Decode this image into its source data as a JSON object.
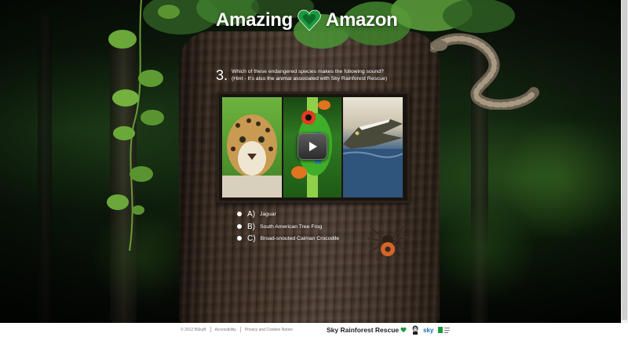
{
  "header": {
    "title_left": "Amazing",
    "title_right": "Amazon",
    "heart_color": "#1a9a3c"
  },
  "question": {
    "number": "3.",
    "text": "Which of these endangered species makes the following sound?",
    "hint": "(Hint - It's also the animal associated with Sky Rainforest Rescue)"
  },
  "media": {
    "images": [
      "jaguar-photo",
      "tree-frog-photo",
      "caiman-photo"
    ],
    "play_icon": "play-icon"
  },
  "options": [
    {
      "letter": "A)",
      "label": "Jaguar"
    },
    {
      "letter": "B)",
      "label": "South American Tree Frog"
    },
    {
      "letter": "C)",
      "label": "Broad-snouted Caiman Crocodile"
    }
  ],
  "footer": {
    "copyright": "© 2012 BSkyB",
    "accessibility": "Accessibility",
    "privacy": "Privacy and Cookies Notice",
    "brand": "Sky Rainforest Rescue",
    "brand_accent": "#1a9a3c"
  }
}
